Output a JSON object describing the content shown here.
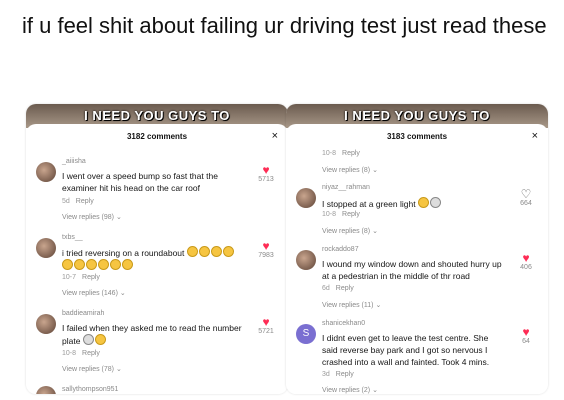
{
  "headline": "if u feel shit about failing ur driving test just read these",
  "panels": [
    {
      "banner": "I NEED YOU GUYS TO",
      "comments_count": "3182 comments",
      "close": "×",
      "comments": [
        {
          "user": "_aiiisha",
          "text": "I went over a speed bump so fast that the examiner hit his head on the car roof",
          "meta": "5d",
          "reply": "Reply",
          "view": "View replies (98)",
          "likes": "5713"
        },
        {
          "user": "txbs__",
          "text": "i tried reversing on a roundabout",
          "meta": "10-7",
          "reply": "Reply",
          "view": "View replies (146)",
          "likes": "7983"
        },
        {
          "user": "baddieamirah",
          "text": "I failed when they asked me to read the number plate",
          "meta": "10-8",
          "reply": "Reply",
          "view": "View replies (78)",
          "likes": "5721"
        },
        {
          "user": "sallythompson951"
        }
      ]
    },
    {
      "banner": "I NEED YOU GUYS TO",
      "comments_count": "3183 comments",
      "close": "×",
      "top_meta": "10-8",
      "top_reply": "Reply",
      "top_view": "View replies (8)",
      "comments": [
        {
          "user": "niyaz__rahman",
          "text": "I stopped at a green light",
          "meta": "10-8",
          "reply": "Reply",
          "view": "View replies (8)",
          "likes": "664"
        },
        {
          "user": "rockaddo87",
          "text": "I wound my window down and shouted hurry up at a pedestrian in the middle of thr road",
          "meta": "6d",
          "reply": "Reply",
          "view": "View replies (11)",
          "likes": "406"
        },
        {
          "user": "shanicekhan0",
          "avatar_letter": "S",
          "text": "I didnt even get to leave the test centre. She said reverse bay park and I got so nervous I crashed into a wall and fainted. Took 4 mins.",
          "meta": "3d",
          "reply": "Reply",
          "view": "View replies (2)",
          "likes": "64"
        }
      ]
    }
  ],
  "icons": {
    "heart": "heart-icon",
    "chevron": "chevron-down-icon",
    "close": "close-icon"
  },
  "colors": {
    "heart": "#fe2c55",
    "muted": "#8a8a8a"
  }
}
